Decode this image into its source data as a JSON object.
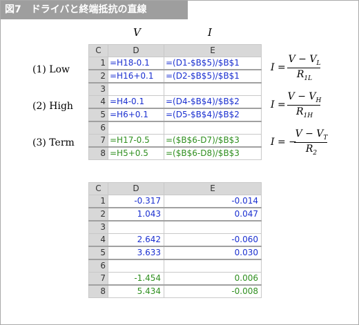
{
  "title": "図7　ドライバと終端抵抗の直線",
  "variables": {
    "v": "V",
    "i": "I"
  },
  "rows": {
    "low": "(1) Low",
    "high": "(2) High",
    "term": "(3) Term"
  },
  "formula_table": {
    "corner": "C",
    "col_d": "D",
    "col_e": "E",
    "rows": [
      {
        "n": "1",
        "d": "=H18-0.1",
        "e": "=(D1-$B$5)/$B$1"
      },
      {
        "n": "2",
        "d": "=H16+0.1",
        "e": "=(D2-$B$5)/$B$1"
      },
      {
        "n": "3",
        "d": "",
        "e": ""
      },
      {
        "n": "4",
        "d": "=H4-0.1",
        "e": "=(D4-$B$4)/$B$2"
      },
      {
        "n": "5",
        "d": "=H6+0.1",
        "e": "=(D5-$B$4)/$B$2"
      },
      {
        "n": "6",
        "d": "",
        "e": ""
      },
      {
        "n": "7",
        "d": "=H17-0.5",
        "e": "=($B$6-D7)/$B$3"
      },
      {
        "n": "8",
        "d": "=H5+0.5",
        "e": "=($B$6-D8)/$B$3"
      }
    ]
  },
  "value_table": {
    "corner": "C",
    "col_d": "D",
    "col_e": "E",
    "rows": [
      {
        "n": "1",
        "d": "-0.317",
        "e": "-0.014"
      },
      {
        "n": "2",
        "d": "1.043",
        "e": "0.047"
      },
      {
        "n": "3",
        "d": "",
        "e": ""
      },
      {
        "n": "4",
        "d": "2.642",
        "e": "-0.060"
      },
      {
        "n": "5",
        "d": "3.633",
        "e": "0.030"
      },
      {
        "n": "6",
        "d": "",
        "e": ""
      },
      {
        "n": "7",
        "d": "-1.454",
        "e": "0.006"
      },
      {
        "n": "8",
        "d": "5.434",
        "e": "-0.008"
      }
    ]
  },
  "equations": {
    "low": {
      "lhs": "I =",
      "num": "V − V",
      "num_sub": "L",
      "den": "R",
      "den_sub": "1L"
    },
    "high": {
      "lhs": "I =",
      "num": "V − V",
      "num_sub": "H",
      "den": "R",
      "den_sub": "1H"
    },
    "term": {
      "lhs": "I = −",
      "num": "V − V",
      "num_sub": "T",
      "den": "R",
      "den_sub": "2"
    }
  },
  "colors": {
    "blue": "#1a2fd0",
    "green": "#2f8f1f",
    "header_gray": "#d8d8d8",
    "title_bg": "#9e9e9e"
  }
}
